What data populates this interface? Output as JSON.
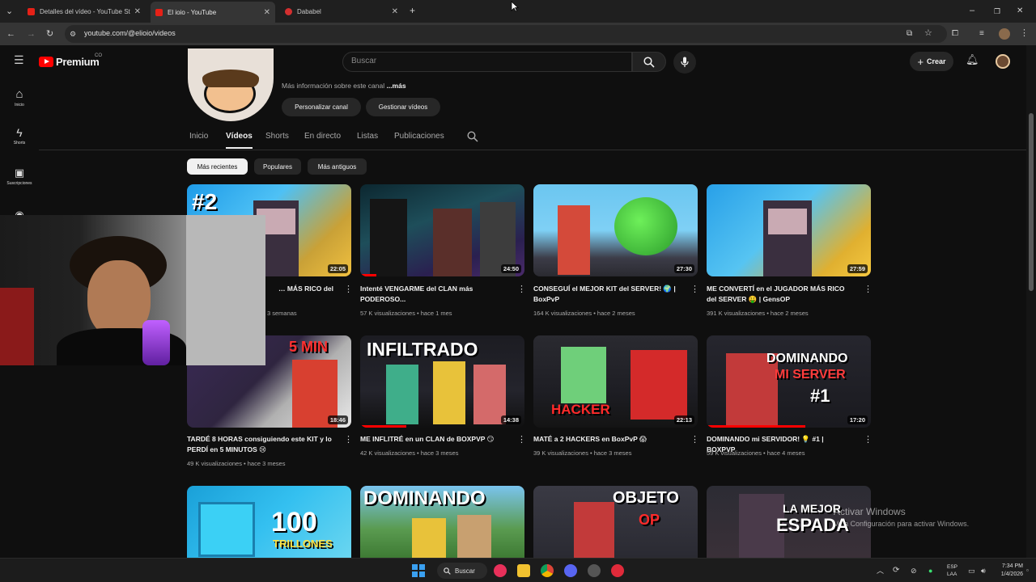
{
  "browser": {
    "tabs": [
      {
        "label": "Detalles del vídeo - YouTube St"
      },
      {
        "label": "El ioio - YouTube"
      },
      {
        "label": "Dababel"
      }
    ],
    "url": "youtube.com/@elioio/videos"
  },
  "youtube": {
    "logo": "Premium",
    "region": "CO",
    "search_placeholder": "Buscar",
    "create_label": "Crear",
    "guide": [
      {
        "label": "Inicio",
        "icon": "home-icon"
      },
      {
        "label": "Shorts",
        "icon": "shorts-icon"
      },
      {
        "label": "Suscripciones",
        "icon": "subscriptions-icon"
      }
    ],
    "channel": {
      "more_info": "Más información sobre este canal",
      "more_link": "...más",
      "customize_button": "Personalizar canal",
      "manage_button": "Gestionar vídeos"
    },
    "nav_tabs": [
      "Inicio",
      "Vídeos",
      "Shorts",
      "En directo",
      "Listas",
      "Publicaciones"
    ],
    "active_tab": "Vídeos",
    "filters": [
      "Más recientes",
      "Populares",
      "Más antiguos"
    ],
    "videos": [
      {
        "title": "… MÁS RICO del",
        "meta_tail": "3 semanas",
        "duration": "22:05"
      },
      {
        "title": "Intenté VENGARME del CLAN más PODEROSO...",
        "meta": "57 K visualizaciones • hace 1 mes",
        "duration": "24:50"
      },
      {
        "title": "CONSEGUÍ el MEJOR KIT del SERVER! 🌍 | BoxPvP",
        "meta": "164 K visualizaciones • hace 2 meses",
        "duration": "27:30"
      },
      {
        "title": "ME CONVERTÍ en el JUGADOR MÁS RICO del SERVER 🤑 | GensOP",
        "meta": "391 K visualizaciones • hace 2 meses",
        "duration": "27:59"
      },
      {
        "title": "TARDÉ 8 HORAS consiguiendo este KIT y lo PERDÍ en 5 MINUTOS 😢",
        "meta": "49 K visualizaciones • hace 3 meses",
        "duration": "18:46"
      },
      {
        "title": "ME INFLITRÉ en un CLAN de BOXPVP 😏",
        "meta": "42 K visualizaciones • hace 3 meses",
        "duration": "14:38"
      },
      {
        "title": "MATÉ a 2 HACKERS en BoxPvP 😱",
        "meta": "39 K visualizaciones • hace 3 meses",
        "duration": "22:13"
      },
      {
        "title": "DOMINANDO mi SERVIDOR! 💡 #1 | BOXPVP",
        "meta": "59 K visualizaciones • hace 4 meses",
        "duration": "17:20"
      }
    ],
    "thumb_text": {
      "t1": "#2",
      "t5": "5 MIN",
      "t6": "INFILTRADO",
      "t7": "HACKER",
      "t8a": "DOMINANDO",
      "t8b": "MI SERVER",
      "t8c": "#1",
      "t9a": "100",
      "t9b": "TRILLONES",
      "t10": "DOMINANDO",
      "t11a": "OBJETO",
      "t11b": "OP",
      "t12a": "LA MEJOR",
      "t12b": "ESPADA"
    }
  },
  "windows": {
    "watermark_title": "Activar Windows",
    "watermark_sub": "Ve a Configuración para activar Windows.",
    "search_label": "Buscar",
    "lang": "ESP",
    "lang2": "LAA",
    "time": "7:34 PM",
    "date": "1/4/2026"
  }
}
